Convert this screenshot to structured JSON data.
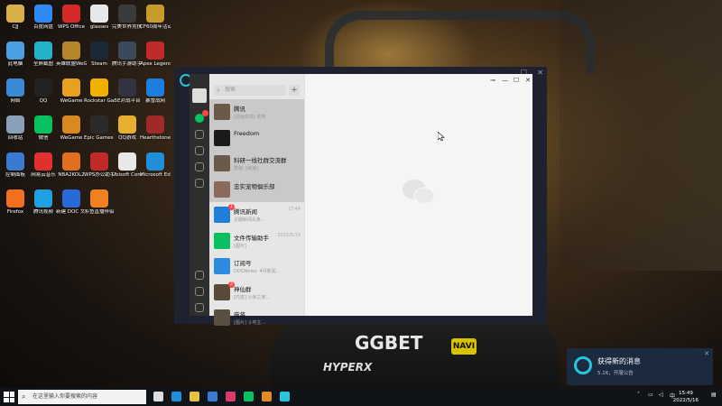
{
  "desktop": {
    "icons": [
      {
        "label": "CJJ",
        "color": "#d8b04a",
        "icon": "folder-icon"
      },
      {
        "label": "百度网盘",
        "color": "#2f8af5",
        "icon": "cloud-icon"
      },
      {
        "label": "WPS Office",
        "color": "#d42a2a",
        "icon": "wps-icon"
      },
      {
        "label": "glasses",
        "color": "#e8e8e8",
        "icon": "file-icon"
      },
      {
        "label": "完美世界竞技平台",
        "color": "#3a3a3a",
        "icon": "game-icon"
      },
      {
        "label": "CF60周年活动助手",
        "color": "#c89a2a",
        "icon": "game-icon"
      },
      {
        "label": "此电脑",
        "color": "#4aa0e0",
        "icon": "computer-icon"
      },
      {
        "label": "全屏截图",
        "color": "#23b3c9",
        "icon": "screenshot-icon"
      },
      {
        "label": "英雄联盟WeGame版",
        "color": "#b8862a",
        "icon": "game-icon"
      },
      {
        "label": "Steam",
        "color": "#1b2838",
        "icon": "steam-icon"
      },
      {
        "label": "腾讯手游助手官方版",
        "color": "#3a4a5a",
        "icon": "game-icon"
      },
      {
        "label": "Apex Legends",
        "color": "#c02a2a",
        "icon": "apex-icon"
      },
      {
        "label": "网络",
        "color": "#3a8ad8",
        "icon": "network-icon"
      },
      {
        "label": "QQ",
        "color": "#222",
        "icon": "qq-icon"
      },
      {
        "label": "WeGame",
        "color": "#e8a020",
        "icon": "wegame-icon"
      },
      {
        "label": "Rockstar Games...",
        "color": "#f0b000",
        "icon": "rockstar-icon"
      },
      {
        "label": "5E对战平台",
        "color": "#334",
        "icon": "game-icon"
      },
      {
        "label": "暴雪战网",
        "color": "#1c7fe0",
        "icon": "battlenet-icon"
      },
      {
        "label": "回收站",
        "color": "#8aa0b8",
        "icon": "recycle-bin-icon"
      },
      {
        "label": "微信",
        "color": "#07c160",
        "icon": "wechat-icon"
      },
      {
        "label": "WeGame",
        "color": "#d88a20",
        "icon": "wegame-icon"
      },
      {
        "label": "Epic Games Launcher",
        "color": "#2a2a2a",
        "icon": "epic-icon"
      },
      {
        "label": "QQ游戏",
        "color": "#e8b030",
        "icon": "game-icon"
      },
      {
        "label": "Hearthstone Deck Trac...",
        "color": "#a02a2a",
        "icon": "game-icon"
      },
      {
        "label": "控制面板",
        "color": "#3a7ad0",
        "icon": "control-panel-icon"
      },
      {
        "label": "网易云音乐",
        "color": "#e03030",
        "icon": "music-icon"
      },
      {
        "label": "NBA2KOL2",
        "color": "#e07020",
        "icon": "game-icon"
      },
      {
        "label": "WPS办公助手",
        "color": "#c02a2a",
        "icon": "wps-icon"
      },
      {
        "label": "Ubisoft Connect",
        "color": "#e8e8e8",
        "icon": "ubisoft-icon"
      },
      {
        "label": "Microsoft Edge",
        "color": "#1e8fd8",
        "icon": "edge-icon"
      },
      {
        "label": "Firefox",
        "color": "#f07020",
        "icon": "firefox-icon"
      },
      {
        "label": "腾讯视频",
        "color": "#20a0e0",
        "icon": "video-icon"
      },
      {
        "label": "新建 DOC 文档",
        "color": "#2a6ad8",
        "icon": "doc-icon"
      },
      {
        "label": "斗鱼直播伴侣",
        "color": "#f08020",
        "icon": "game-icon"
      }
    ]
  },
  "wechat": {
    "search_placeholder": "搜索",
    "plus": "+",
    "chats": [
      {
        "name": "腾讯",
        "msg": "[动画表情] 收到",
        "time": "",
        "color": "#6b5a4a",
        "badge": ""
      },
      {
        "name": "Freedom",
        "msg": "",
        "time": "",
        "color": "#1a1a1a",
        "badge": ""
      },
      {
        "name": "科研一线社群交流群",
        "msg": "群聊: [链接]",
        "time": "",
        "color": "#6a5a4a",
        "badge": ""
      },
      {
        "name": "忠实宠物俱乐部",
        "msg": "",
        "time": "",
        "color": "#8a6a5a",
        "badge": ""
      },
      {
        "name": "腾讯新闻",
        "msg": "近期新闻头条...",
        "time": "17:44",
        "color": "#1e7fd8",
        "badge": "1"
      },
      {
        "name": "文件传输助手",
        "msg": "[图片]",
        "time": "2022/5/14",
        "color": "#07c160",
        "badge": ""
      },
      {
        "name": "订阅号",
        "msg": "DOGNews: 4月新闻...",
        "time": "",
        "color": "#2c8ae0",
        "badge": ""
      },
      {
        "name": "神仙群",
        "msg": "[内容] 小米之家...",
        "time": "",
        "color": "#5a4a3a",
        "badge": "2"
      },
      {
        "name": "麻将",
        "msg": "[图片] 斗地主...",
        "time": "",
        "color": "#5a5040",
        "badge": ""
      }
    ],
    "window_controls": [
      "⊸",
      "—",
      "☐",
      "✕"
    ]
  },
  "toast": {
    "title": "获得新的消息",
    "body": "5.16，开服公告"
  },
  "taskbar": {
    "search_placeholder": "在这里输入你要搜索的内容",
    "time": "15:49",
    "date": "2022/5/16",
    "lang": "中",
    "apps": [
      {
        "name": "task-view-icon",
        "color": "#ddd"
      },
      {
        "name": "edge-icon",
        "color": "#1e8fd8"
      },
      {
        "name": "file-explorer-icon",
        "color": "#e8c040"
      },
      {
        "name": "mail-icon",
        "color": "#3a7ad0"
      },
      {
        "name": "store-icon",
        "color": "#d83a6a"
      },
      {
        "name": "wechat-icon",
        "color": "#07c160"
      },
      {
        "name": "app-icon",
        "color": "#e08a20"
      },
      {
        "name": "wegame-icon",
        "color": "#25c6de"
      }
    ]
  },
  "jersey": {
    "logo": "GGBET",
    "partner": "HYPERX",
    "team": "NAVI"
  }
}
